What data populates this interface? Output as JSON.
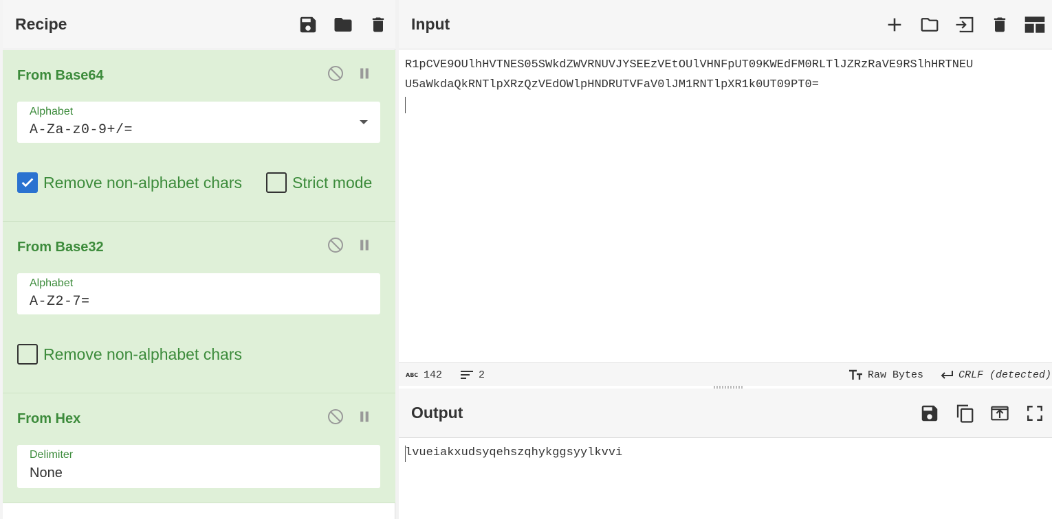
{
  "recipe": {
    "title": "Recipe",
    "header_icons": [
      "save-icon",
      "folder-icon",
      "trash-icon"
    ],
    "operations": [
      {
        "name": "From Base64",
        "field": {
          "label": "Alphabet",
          "value": "A-Za-z0-9+/="
        },
        "checkboxes": [
          {
            "label": "Remove non-alphabet chars",
            "checked": true
          },
          {
            "label": "Strict mode",
            "checked": false
          }
        ]
      },
      {
        "name": "From Base32",
        "field": {
          "label": "Alphabet",
          "value": "A-Z2-7="
        },
        "checkboxes": [
          {
            "label": "Remove non-alphabet chars",
            "checked": false
          }
        ]
      },
      {
        "name": "From Hex",
        "field": {
          "label": "Delimiter",
          "value": "None"
        }
      }
    ]
  },
  "input": {
    "title": "Input",
    "header_icons": [
      "plus-icon",
      "folder-icon",
      "load-input-icon",
      "trash-icon",
      "layout-icon"
    ],
    "line1": "R1pCVE9OUlhHVTNES05SWkdZWVRNUVJYSEEzVEtOUlVHNFpUT09KWEdFM0RLTlJZRzRaVE9RSlhHRTNEU",
    "line2": "U5aWkdaQkRNTlpXRzQzVEdOWlpHNDRUTVFaV0lJM1RNTlpXR1k0UT09PT0=",
    "status": {
      "abc_label": "ABC",
      "length": "142",
      "lines": "2",
      "encoding": "Raw Bytes",
      "eol": "CRLF (detected)"
    }
  },
  "output": {
    "title": "Output",
    "header_icons": [
      "save-icon",
      "copy-icon",
      "replace-input-icon",
      "maximize-icon"
    ],
    "text": "lvueiakxudsyqehszqhykggsyylkvvi"
  }
}
